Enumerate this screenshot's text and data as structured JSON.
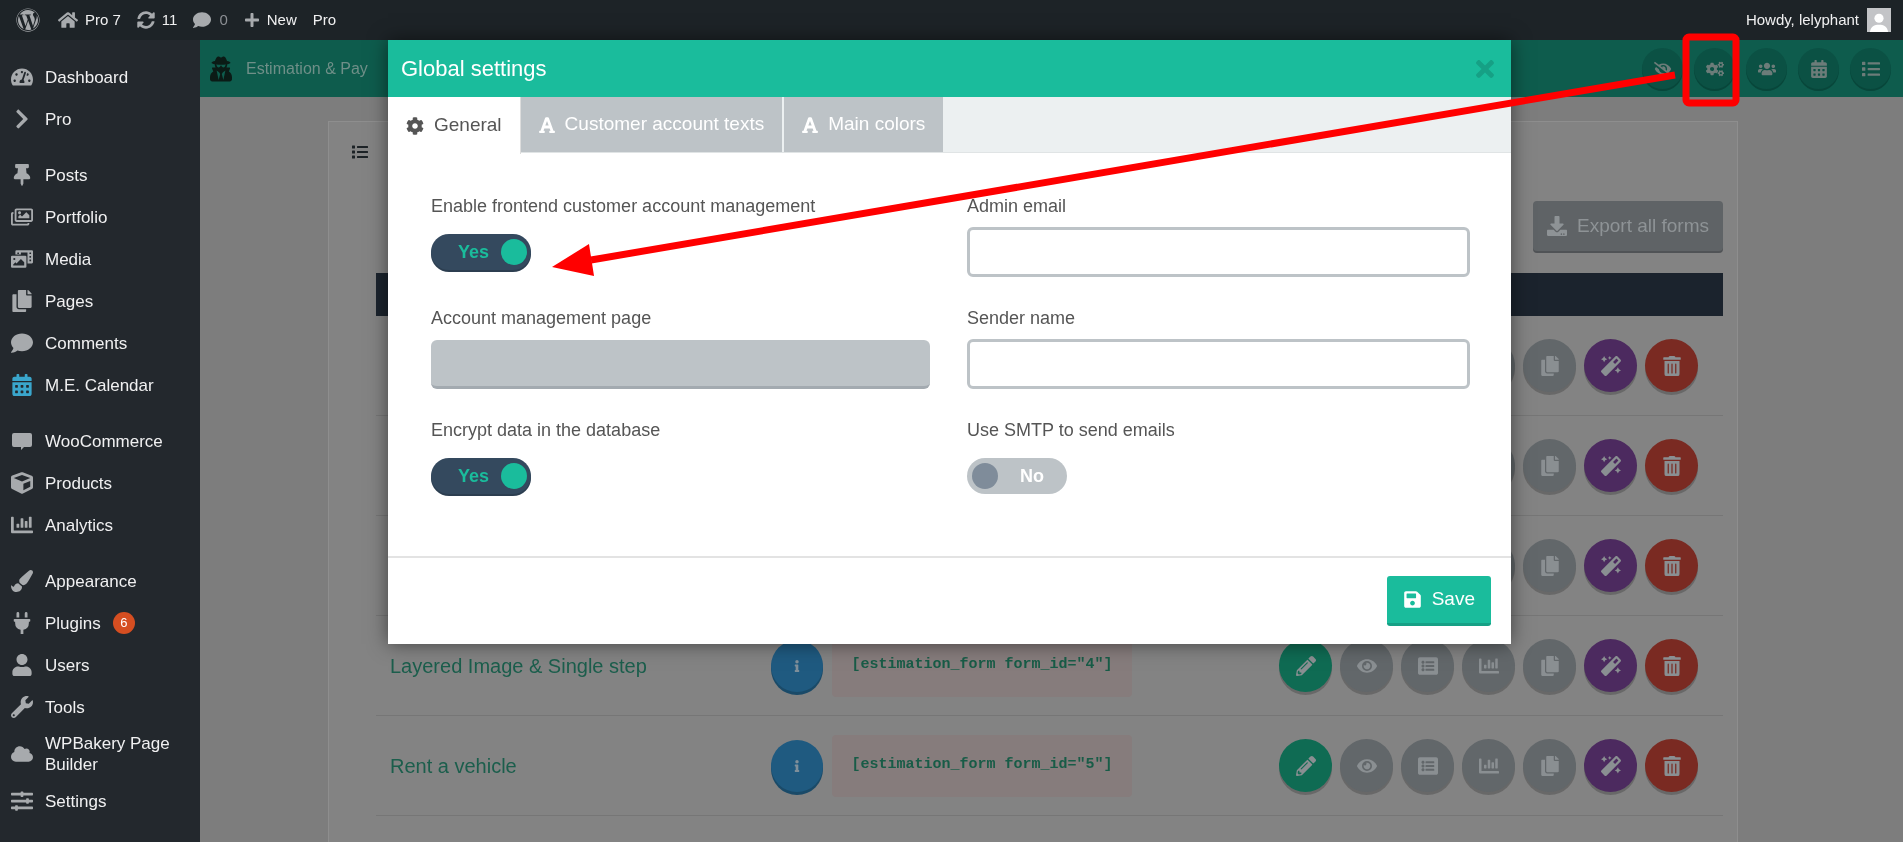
{
  "admin_bar": {
    "items": [
      {
        "kind": "logo"
      },
      {
        "kind": "site",
        "label": "Pro 7"
      },
      {
        "kind": "updates",
        "label": "11"
      },
      {
        "kind": "comments",
        "label": "0"
      },
      {
        "kind": "new",
        "label": "New"
      },
      {
        "kind": "plain",
        "label": "Pro"
      }
    ],
    "greeting": "Howdy, lelyphant"
  },
  "sidebar": {
    "sections": [
      {
        "items": [
          {
            "label": "Dashboard"
          },
          {
            "label": "Pro"
          }
        ]
      },
      {
        "items": [
          {
            "label": "Posts"
          },
          {
            "label": "Portfolio"
          },
          {
            "label": "Media"
          },
          {
            "label": "Pages"
          },
          {
            "label": "Comments"
          },
          {
            "label": "M.E. Calendar"
          }
        ]
      },
      {
        "items": [
          {
            "label": "WooCommerce"
          },
          {
            "label": "Products"
          },
          {
            "label": "Analytics"
          }
        ]
      },
      {
        "items": [
          {
            "label": "Appearance"
          },
          {
            "label": "Plugins",
            "badge": "6"
          },
          {
            "label": "Users"
          },
          {
            "label": "Tools"
          },
          {
            "label": "WPBakery Page Builder"
          },
          {
            "label": "Settings"
          }
        ]
      }
    ]
  },
  "plugin_header": {
    "title": "Estimation & Pay"
  },
  "forms_panel": {
    "export_button": "Export all forms",
    "rows": [
      {
        "kind": "covered"
      },
      {
        "kind": "covered"
      },
      {
        "kind": "covered"
      },
      {
        "kind": "form",
        "name": "Layered Image & Single step",
        "shortcode": "[estimation_form form_id=\"4\"]"
      },
      {
        "kind": "form",
        "name": "Rent a vehicle",
        "shortcode": "[estimation_form form_id=\"5\"]"
      }
    ]
  },
  "modal": {
    "title": "Global settings",
    "tabs": [
      {
        "label": "General",
        "selected": true
      },
      {
        "label": "Customer account texts",
        "selected": false
      },
      {
        "label": "Main colors",
        "selected": false
      }
    ],
    "fields": [
      {
        "kind": "toggle",
        "label": "Enable frontend customer account management",
        "on": true,
        "value": "Yes"
      },
      {
        "kind": "input",
        "label": "Admin email"
      },
      {
        "kind": "select",
        "label": "Account management page"
      },
      {
        "kind": "input",
        "label": "Sender name"
      },
      {
        "kind": "toggle",
        "label": "Encrypt data in the database",
        "on": true,
        "value": "Yes"
      },
      {
        "kind": "toggle",
        "label": "Use SMTP to send emails",
        "on": false,
        "value": "No"
      }
    ],
    "save_button": "Save"
  }
}
